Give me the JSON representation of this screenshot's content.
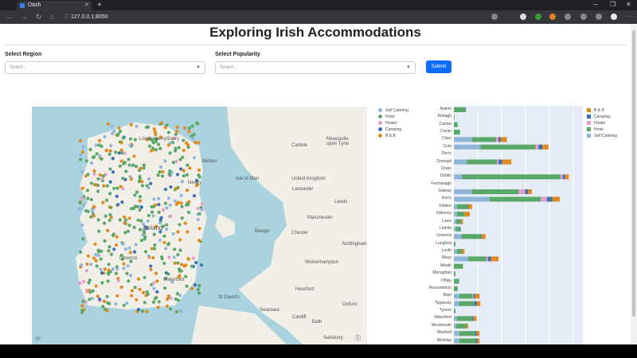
{
  "browser": {
    "tab_title": "Dash",
    "url": "127.0.0.1:8050"
  },
  "page": {
    "title": "Exploring Irish Accommodations",
    "region_label": "Select Region",
    "region_placeholder": "Select...",
    "popularity_label": "Select Popularity",
    "popularity_placeholder": "Select...",
    "submit_label": "Submit"
  },
  "map": {
    "legend": [
      "Self Catering",
      "Hotel",
      "Hostel",
      "Camping",
      "B & B"
    ],
    "place_labels": [
      {
        "text": "Carlisle"
      },
      {
        "text": "Newcastle upon Tyne"
      },
      {
        "text": "Isle of Man"
      },
      {
        "text": "United Kingdom"
      },
      {
        "text": "Lancaster"
      },
      {
        "text": "Leeds"
      },
      {
        "text": "Manchester"
      },
      {
        "text": "Bangor"
      },
      {
        "text": "Chester"
      },
      {
        "text": "Nottingham"
      },
      {
        "text": "Wolverhampton"
      },
      {
        "text": "St David's"
      },
      {
        "text": "Hereford"
      },
      {
        "text": "Swansea"
      },
      {
        "text": "Cardiff"
      },
      {
        "text": "Oxford"
      },
      {
        "text": "Bath"
      },
      {
        "text": "Salisbury"
      },
      {
        "text": "Londonderry/Derry"
      },
      {
        "text": "Belfast"
      },
      {
        "text": "Newry"
      },
      {
        "text": "Ireland"
      },
      {
        "text": "Limerick"
      },
      {
        "text": "Waterford"
      }
    ],
    "colors": {
      "Self Catering": "#8fb6d8",
      "Hotel": "#5aa867",
      "Hostel": "#e89bc8",
      "Camping": "#3d6fb5",
      "B & B": "#e08a1e"
    }
  },
  "chart_data": {
    "type": "bar",
    "orientation": "horizontal",
    "stacked": true,
    "legend": [
      "B & B",
      "Camping",
      "Hostel",
      "Hotel",
      "Self Catering"
    ],
    "categories": [
      "Antrim",
      "Armagh",
      "Carlow",
      "Cavan",
      "Clare",
      "Cork",
      "Derry",
      "Donegal",
      "Down",
      "Dublin",
      "Fermanagh",
      "Galway",
      "Kerry",
      "Kildare",
      "Kilkenny",
      "Laois",
      "Leitrim",
      "Limerick",
      "Longford",
      "Louth",
      "Mayo",
      "Meath",
      "Monaghan",
      "Offaly",
      "Roscommon",
      "Sligo",
      "Tipperary",
      "Tyrone",
      "Waterford",
      "Westmeath",
      "Wexford",
      "Wicklow"
    ],
    "series": [
      {
        "name": "Self Catering",
        "values": [
          0,
          0,
          0,
          0,
          24,
          35,
          0,
          17,
          0,
          11,
          0,
          24,
          47,
          4,
          4,
          3,
          3,
          10,
          0,
          4,
          19,
          0,
          0,
          0,
          0,
          7,
          7,
          0,
          4,
          3,
          7,
          7
        ]
      },
      {
        "name": "Hotel",
        "values": [
          16,
          1,
          5,
          8,
          32,
          73,
          0,
          40,
          0,
          130,
          0,
          62,
          68,
          14,
          10,
          7,
          5,
          26,
          2,
          7,
          24,
          12,
          2,
          7,
          5,
          18,
          20,
          2,
          20,
          14,
          21,
          22
        ]
      },
      {
        "name": "Hostel",
        "values": [
          0,
          0,
          0,
          0,
          3,
          4,
          0,
          2,
          0,
          3,
          0,
          8,
          8,
          0,
          0,
          0,
          0,
          0,
          0,
          0,
          2,
          0,
          0,
          0,
          0,
          1,
          0,
          0,
          0,
          0,
          0,
          0
        ]
      },
      {
        "name": "Camping",
        "values": [
          0,
          0,
          0,
          0,
          3,
          5,
          0,
          5,
          0,
          3,
          0,
          4,
          7,
          1,
          0,
          0,
          1,
          1,
          0,
          0,
          4,
          0,
          0,
          0,
          0,
          2,
          3,
          0,
          2,
          0,
          2,
          2
        ]
      },
      {
        "name": "B & B",
        "values": [
          0,
          0,
          0,
          0,
          8,
          8,
          0,
          12,
          0,
          5,
          0,
          5,
          10,
          5,
          7,
          2,
          0,
          5,
          0,
          3,
          10,
          0,
          0,
          0,
          0,
          6,
          5,
          0,
          4,
          2,
          4,
          3
        ]
      }
    ],
    "colors": {
      "B & B": "#e08a1e",
      "Camping": "#3d6fb5",
      "Hostel": "#e89bc8",
      "Hotel": "#5aa867",
      "Self Catering": "#8fb6d8"
    }
  }
}
